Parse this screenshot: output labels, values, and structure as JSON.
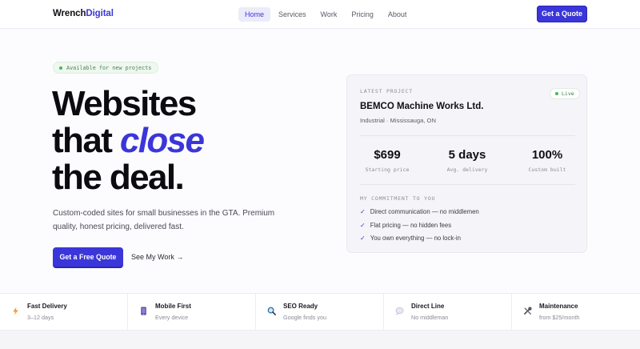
{
  "nav": {
    "logo_main": "Wrench",
    "logo_accent": "Digital",
    "links": [
      "Home",
      "Services",
      "Work",
      "Pricing",
      "About"
    ],
    "active_link": "Home",
    "cta": "Get a Quote"
  },
  "hero": {
    "badge": "Available for new projects",
    "headline_line1": "Websites",
    "headline_line2_start": "that ",
    "headline_line2_accent": "close",
    "headline_line3": "the deal.",
    "subtext": "Custom-coded sites for small businesses in the GTA. Premium quality, honest pricing, delivered fast.",
    "primary_cta": "Get a Free Quote",
    "secondary_cta": "See My Work →"
  },
  "card": {
    "kicker": "LATEST PROJECT",
    "status": "Live",
    "title": "BEMCO Machine Works Ltd.",
    "meta": "Industrial · Mississauga, ON",
    "stats": [
      {
        "value": "$699",
        "label": "Starting price"
      },
      {
        "value": "5 days",
        "label": "Avg. delivery"
      },
      {
        "value": "100%",
        "label": "Custom built"
      }
    ],
    "commitment_kicker": "MY COMMITMENT TO YOU",
    "commitments": [
      "Direct communication — no middlemen",
      "Flat pricing — no hidden fees",
      "You own everything — no lock-in"
    ]
  },
  "features": [
    {
      "icon": "lightning-icon",
      "title": "Fast Delivery",
      "subtitle": "3–12 days"
    },
    {
      "icon": "mobile-icon",
      "title": "Mobile First",
      "subtitle": "Every device"
    },
    {
      "icon": "magnifier-icon",
      "title": "SEO Ready",
      "subtitle": "Google finds you"
    },
    {
      "icon": "chat-bubble-icon",
      "title": "Direct Line",
      "subtitle": "No middleman"
    },
    {
      "icon": "tools-icon",
      "title": "Maintenance",
      "subtitle": "from $25/month"
    }
  ],
  "colors": {
    "accent": "#3b36d9",
    "live_green": "#4fb062"
  }
}
